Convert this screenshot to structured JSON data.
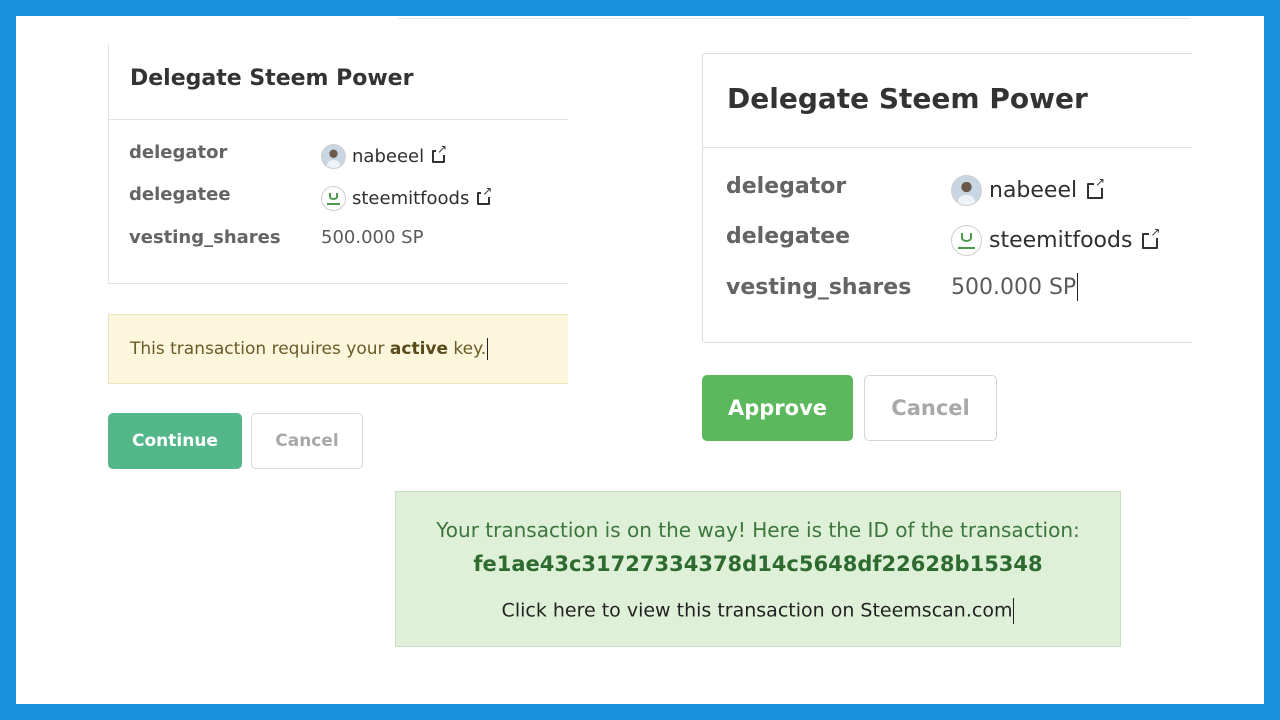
{
  "left_panel": {
    "title": "Delegate Steem Power",
    "rows": [
      {
        "label": "delegator",
        "value": "nabeeel"
      },
      {
        "label": "delegatee",
        "value": "steemitfoods"
      },
      {
        "label": "vesting_shares",
        "value": "500.000 SP"
      }
    ],
    "notice": {
      "prefix": "This transaction requires your ",
      "key": "active",
      "suffix": " key."
    },
    "continue_label": "Continue",
    "cancel_label": "Cancel"
  },
  "right_panel": {
    "title": "Delegate Steem Power",
    "rows": [
      {
        "label": "delegator",
        "value": "nabeeel"
      },
      {
        "label": "delegatee",
        "value": "steemitfoods"
      },
      {
        "label": "vesting_shares",
        "value": "500.000 SP"
      }
    ],
    "approve_label": "Approve",
    "cancel_label": "Cancel"
  },
  "success": {
    "message": "Your transaction is on the way! Here is the ID of the transaction:",
    "transaction_id": "fe1ae43c31727334378d14c5648df22628b15348",
    "link_text": "Click here to view this transaction on Steemscan.com"
  },
  "colors": {
    "frame": "#1a8fdd",
    "continue": "#53b78a",
    "approve": "#5cb85c",
    "notice_bg": "#fbf6dc",
    "success_bg": "#dff0d8"
  }
}
